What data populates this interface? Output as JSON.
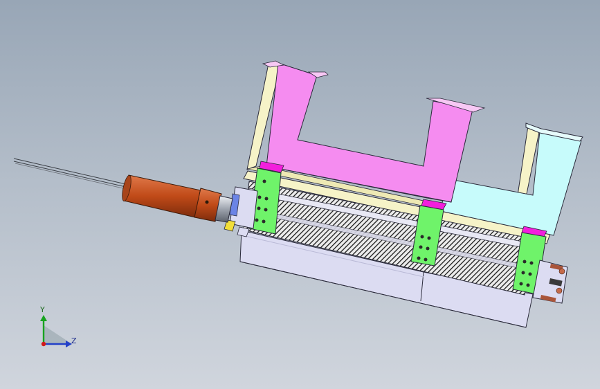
{
  "viewport": {
    "background_top": "#98a6b6",
    "background_bottom": "#d0d5dd"
  },
  "model": {
    "colors": {
      "frame": "#f58cf0",
      "frame_edge": "#4a2d4a",
      "light_cyan_plate": "#c7fbfb",
      "cream_plate": "#f6f3c8",
      "green_blocks": "#6ff36a",
      "magenta_pads": "#f21fdc",
      "orange_cylinder": "#c4501f",
      "base_plate": "#dcdcf2",
      "hatch": "#1a1a1a",
      "blue_clamp": "#6b84e6"
    }
  },
  "triad": {
    "y_label": "Y",
    "z_label": "Z",
    "y_color": "#17a31f",
    "z_color": "#2340c8",
    "origin_color": "#d11a1a"
  }
}
